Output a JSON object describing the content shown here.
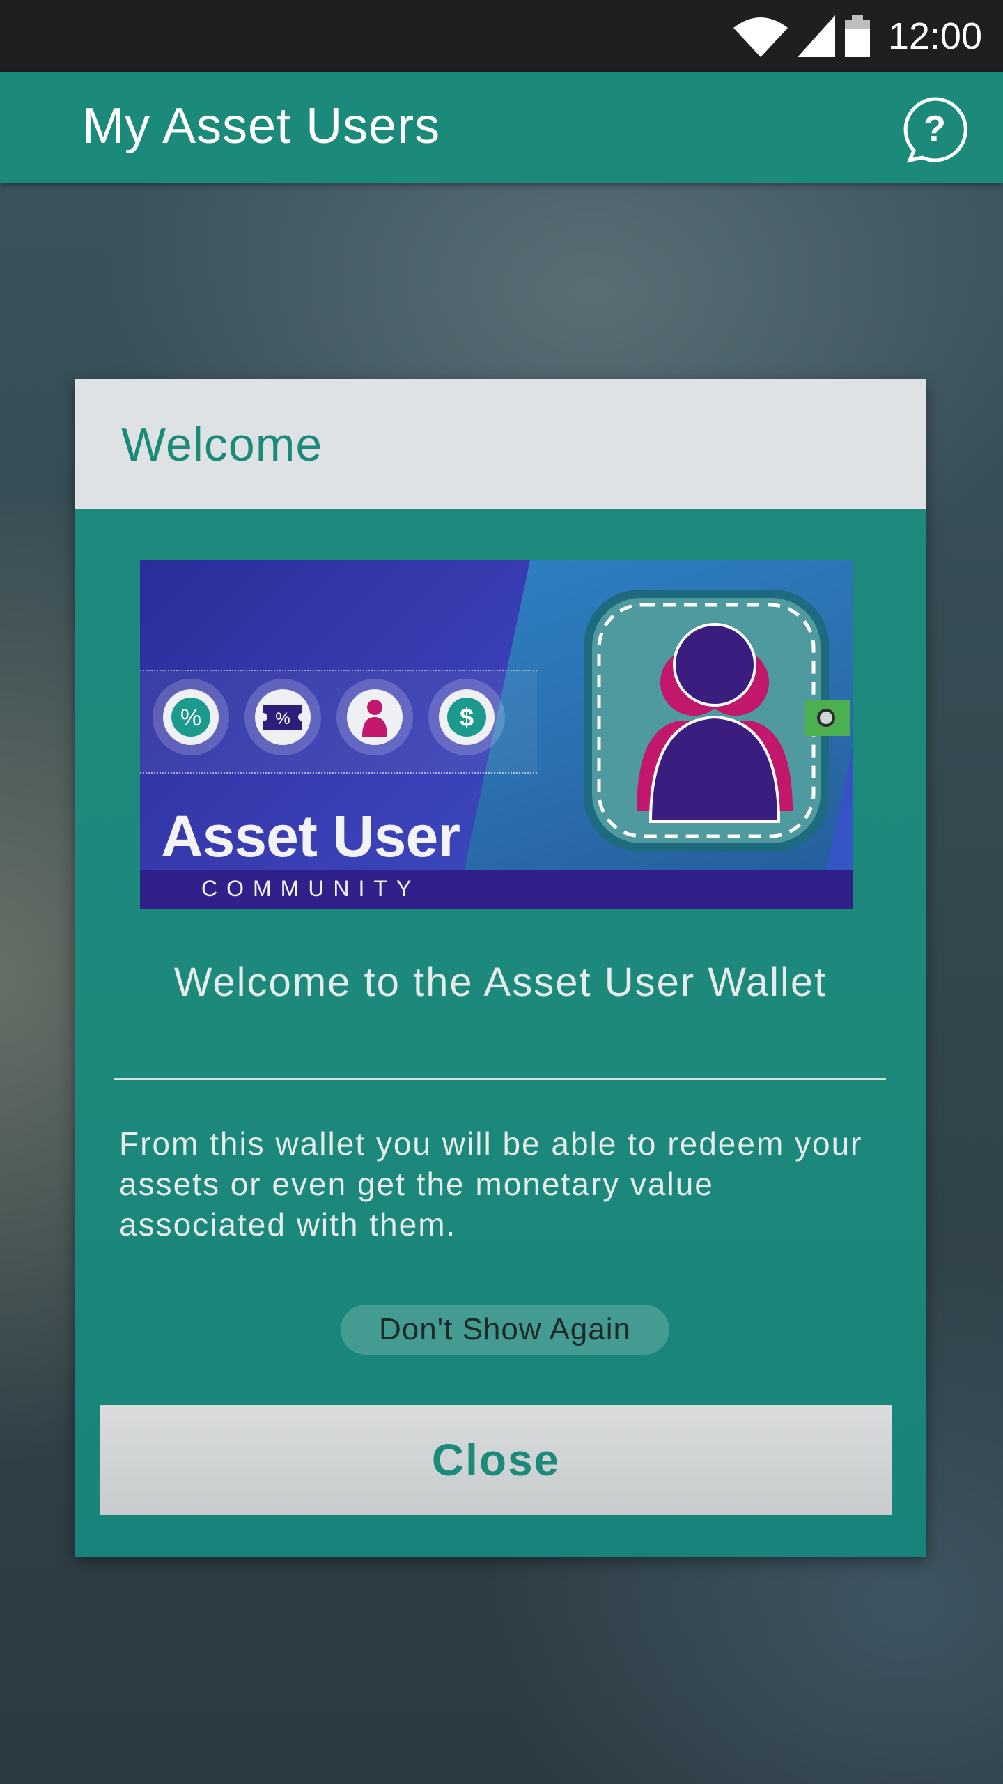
{
  "status_bar": {
    "time": "12:00",
    "icons": [
      "wifi-icon",
      "signal-icon",
      "battery-icon"
    ]
  },
  "app_bar": {
    "title": "My Asset Users",
    "help_icon": "help-icon"
  },
  "dialog": {
    "title": "Welcome",
    "banner": {
      "title": "Asset User",
      "subtitle": "COMMUNITY",
      "coin_icons": [
        "percent-icon",
        "ticket-icon",
        "person-icon",
        "dollar-icon"
      ]
    },
    "heading": "Welcome to the Asset User Wallet",
    "body": "From this wallet you will be able to redeem your assets or even get the monetary value associated with them.",
    "dont_show_label": "Don't Show Again",
    "close_label": "Close"
  },
  "colors": {
    "accent": "#1b8a7b",
    "status_bar": "#1f1f1f",
    "dialog_header": "#dee2e4",
    "banner_blue": "#2a2e9a",
    "banner_footer": "#31208a",
    "magenta": "#c2186c"
  }
}
